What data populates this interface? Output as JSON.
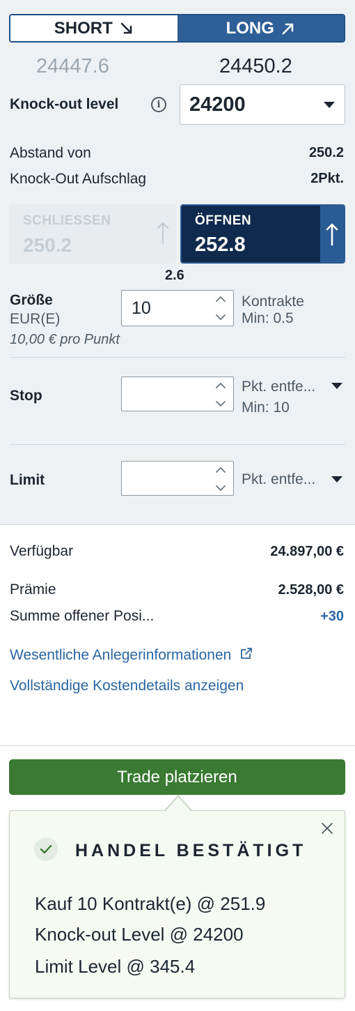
{
  "direction": {
    "short_label": "SHORT",
    "long_label": "LONG",
    "selected": "long",
    "selected_color": "#2e5f96"
  },
  "prices": {
    "sell": "24447.6",
    "buy": "24450.2"
  },
  "knockout": {
    "label": "Knock-out level",
    "value": "24200"
  },
  "info": {
    "distance_label": "Abstand von",
    "distance_value": "250.2",
    "premium_label": "Knock-Out Aufschlag",
    "premium_value": "2Pkt."
  },
  "tiles": {
    "close_label": "SCHLIESSEN",
    "close_value": "250.2",
    "open_label": "ÖFFNEN",
    "open_value": "252.8",
    "spread": "2.6"
  },
  "size": {
    "label": "Größe",
    "currency": "EUR(E)",
    "value": "10",
    "unit": "Kontrakte",
    "min": "Min: 0.5",
    "per_point": "10,00 € pro Punkt"
  },
  "stop": {
    "label": "Stop",
    "value": "",
    "type": "Pkt. entfe...",
    "min": "Min: 10"
  },
  "limit": {
    "label": "Limit",
    "value": "",
    "type": "Pkt. entfe..."
  },
  "summary": {
    "available_label": "Verfügbar",
    "available_value": "24.897,00 €",
    "premium_label": "Prämie",
    "premium_value": "2.528,00 €",
    "open_pos_label": "Summe offener Posi...",
    "open_pos_value": "+30"
  },
  "links": {
    "kid": "Wesentliche Anlegerinformationen",
    "costs": "Vollständige Kostendetails anzeigen"
  },
  "trade_button": "Trade platzieren",
  "confirmation": {
    "title": "HANDEL BESTÄTIGT",
    "line1": "Kauf 10 Kontrakt(e) @ 251.9",
    "line2": "Knock-out Level @ 24200",
    "line3": "Limit Level @ 345.4"
  },
  "colors": {
    "brand": "#2e5f96",
    "open_tile": "#0f2a4d",
    "trade_button": "#3a7a32",
    "link": "#2a66a3"
  }
}
